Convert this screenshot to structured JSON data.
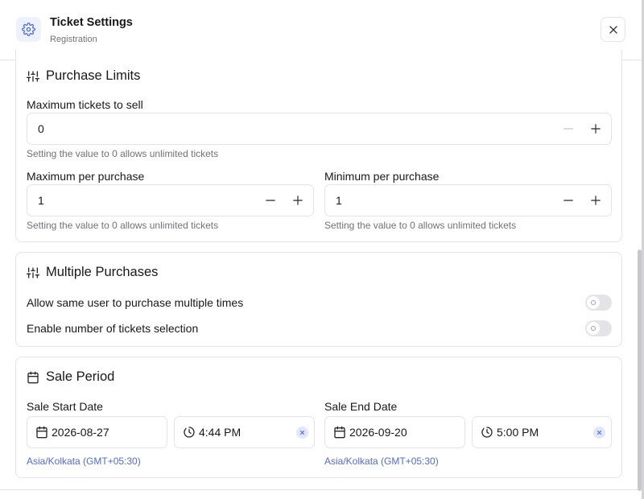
{
  "header": {
    "title": "Ticket Settings",
    "subtitle": "Registration",
    "icon": "gear-icon",
    "close_icon": "close-icon"
  },
  "purchase_limits": {
    "title": "Purchase Limits",
    "icon": "sliders-icon",
    "max_tickets": {
      "label": "Maximum tickets to sell",
      "value": "0",
      "hint": "Setting the value to 0 allows unlimited tickets"
    },
    "max_per_purchase": {
      "label": "Maximum per purchase",
      "value": "1",
      "hint": "Setting the value to 0 allows unlimited tickets"
    },
    "min_per_purchase": {
      "label": "Minimum per purchase",
      "value": "1",
      "hint": "Setting the value to 0 allows unlimited tickets"
    }
  },
  "multiple_purchases": {
    "title": "Multiple Purchases",
    "icon": "sliders-icon",
    "allow_same_user": {
      "label": "Allow same user to purchase multiple times",
      "enabled": false
    },
    "enable_number_selection": {
      "label": "Enable number of tickets selection",
      "enabled": false
    }
  },
  "sale_period": {
    "title": "Sale Period",
    "icon": "calendar-icon",
    "start": {
      "label": "Sale Start Date",
      "date": "2026-08-27",
      "time": "4:44 PM",
      "timezone": "Asia/Kolkata (GMT+05:30)"
    },
    "end": {
      "label": "Sale End Date",
      "date": "2026-09-20",
      "time": "5:00 PM",
      "timezone": "Asia/Kolkata (GMT+05:30)"
    }
  },
  "colors": {
    "accent": "#4f6bd8",
    "border": "#e4e4e7",
    "muted_text": "#71717a"
  }
}
